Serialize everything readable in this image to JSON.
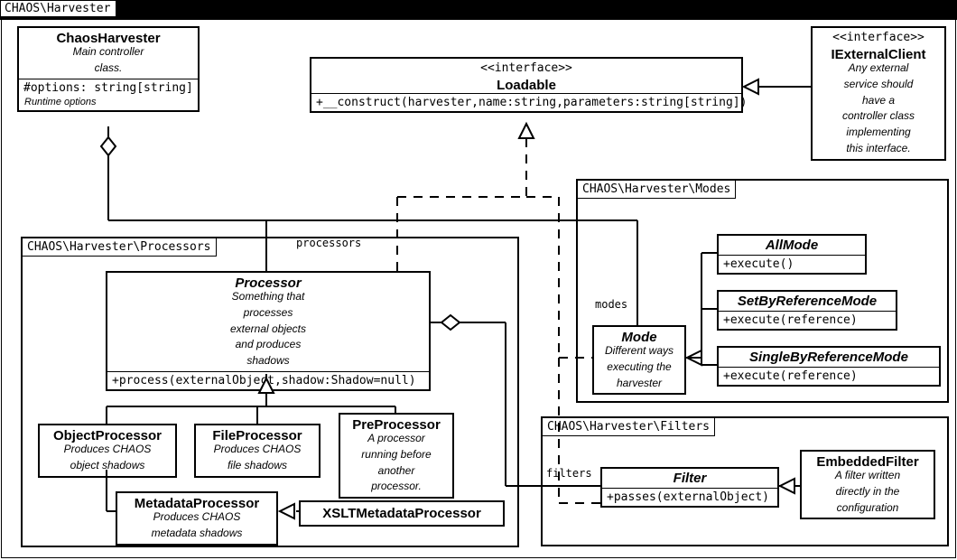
{
  "root_package": "CHAOS\\Harvester",
  "packages": {
    "processors": "CHAOS\\Harvester\\Processors",
    "modes": "CHAOS\\Harvester\\Modes",
    "filters": "CHAOS\\Harvester\\Filters"
  },
  "classes": {
    "chaos_harvester": {
      "name": "ChaosHarvester",
      "desc1": "Main controller",
      "desc2": "class.",
      "member": "#options: string[string]",
      "member_desc": "Runtime options"
    },
    "loadable": {
      "stereo": "<<interface>>",
      "name": "Loadable",
      "op": "+__construct(harvester,name:string,parameters:string[string])"
    },
    "iexternal": {
      "stereo": "<<interface>>",
      "name": "IExternalClient",
      "d1": "Any external",
      "d2": "service should",
      "d3": "have a",
      "d4": "controller class",
      "d5": "implementing",
      "d6": "this interface."
    },
    "processor": {
      "name": "Processor",
      "d1": "Something that",
      "d2": "processes",
      "d3": "external objects",
      "d4": "and produces",
      "d5": "shadows",
      "op": "+process(externalObject,shadow:Shadow=null)"
    },
    "object_processor": {
      "name": "ObjectProcessor",
      "d1": "Produces CHAOS",
      "d2": "object shadows"
    },
    "file_processor": {
      "name": "FileProcessor",
      "d1": "Produces CHAOS",
      "d2": "file shadows"
    },
    "pre_processor": {
      "name": "PreProcessor",
      "d1": "A processor",
      "d2": "running before",
      "d3": "another",
      "d4": "processor."
    },
    "metadata_processor": {
      "name": "MetadataProcessor",
      "d1": "Produces CHAOS",
      "d2": "metadata shadows"
    },
    "xslt_processor": {
      "name": "XSLTMetadataProcessor"
    },
    "mode": {
      "name": "Mode",
      "d1": "Different ways",
      "d2": "executing the",
      "d3": "harvester"
    },
    "all_mode": {
      "name": "AllMode",
      "op": "+execute()"
    },
    "setbyref_mode": {
      "name": "SetByReferenceMode",
      "op": "+execute(reference)"
    },
    "singlebyref_mode": {
      "name": "SingleByReferenceMode",
      "op": "+execute(reference)"
    },
    "filter": {
      "name": "Filter",
      "op": "+passes(externalObject)"
    },
    "embedded_filter": {
      "name": "EmbeddedFilter",
      "d1": "A filter written",
      "d2": "directly in the",
      "d3": "configuration"
    }
  },
  "edges": {
    "processors": "processors",
    "modes": "modes",
    "filters": "filters"
  }
}
